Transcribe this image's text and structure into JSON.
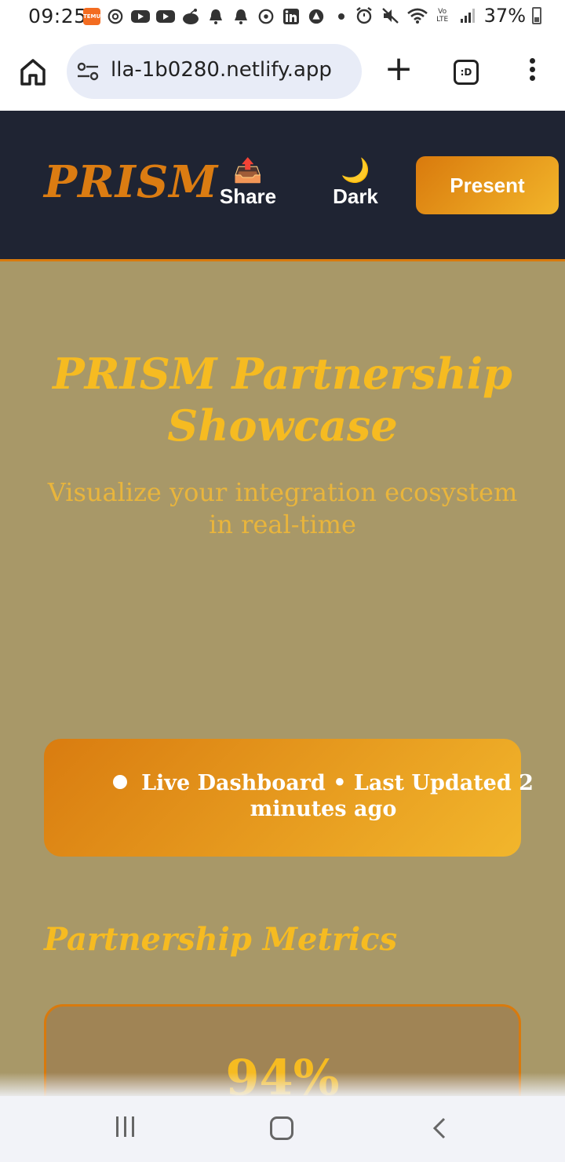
{
  "status_bar": {
    "time": "09:25",
    "temu_label": "TEMU",
    "network_label": "Vo LTE",
    "battery": "37%"
  },
  "browser": {
    "url": "lla-1b0280.netlify.app",
    "tabs_count_label": ":D"
  },
  "header": {
    "logo": "PRISM",
    "share_icon": "📤",
    "share_label": "Share",
    "dark_icon": "🌙",
    "dark_label": "Dark",
    "present_label": "Present"
  },
  "hero": {
    "title": "PRISM Partnership Showcase",
    "subtitle": "Visualize your integration ecosystem in real-time"
  },
  "live_banner": {
    "text": "Live Dashboard • Last Updated 2 minutes ago"
  },
  "metrics": {
    "section_title": "Partnership Metrics",
    "first_value": "94%"
  },
  "colors": {
    "header_bg": "#1f2433",
    "accent_orange": "#d97a0d",
    "accent_gold": "#f6bb21",
    "main_bg": "#a89868"
  }
}
